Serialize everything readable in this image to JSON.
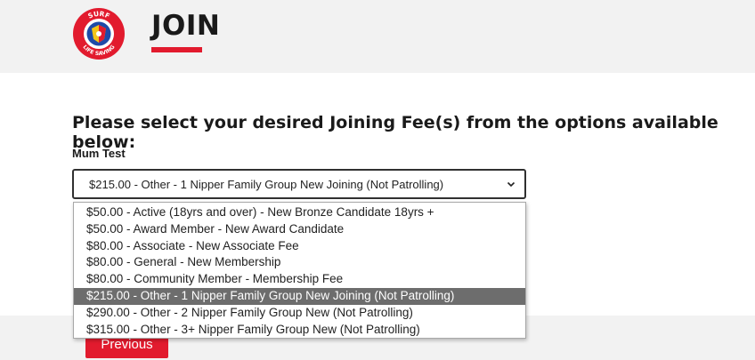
{
  "header": {
    "title": "JOIN",
    "logo": {
      "text_top": "SURF",
      "text_bottom": "LIFE SAVING",
      "colors": {
        "ring": "#e21b2e",
        "inner": "#1e4aa8",
        "flag": "#f5c518"
      }
    }
  },
  "main": {
    "instructions": "Please select your desired Joining Fee(s) from the options available below:",
    "member_name": "Mum Test",
    "fee_select": {
      "selected_value": "$215.00 - Other - 1 Nipper Family Group New Joining (Not Patrolling)",
      "options": [
        "$50.00 - Active (18yrs and over) - New Bronze Candidate 18yrs +",
        "$50.00 - Award Member - New Award Candidate",
        "$80.00 - Associate - New Associate Fee",
        "$80.00 - General - New Membership",
        "$80.00 - Community Member - Membership Fee",
        "$215.00 - Other - 1 Nipper Family Group New Joining (Not Patrolling)",
        "$290.00 - Other - 2 Nipper Family Group New (Not Patrolling)",
        "$315.00 - Other - 3+ Nipper Family Group New (Not Patrolling)"
      ]
    },
    "previous_label": "Previous"
  },
  "colors": {
    "accent": "#e21b2e",
    "header_bg": "#f2f2f2",
    "selected_option_bg": "#6d6d6d"
  }
}
